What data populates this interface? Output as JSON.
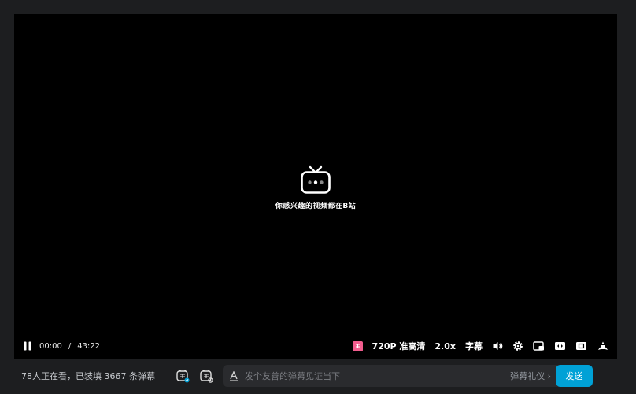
{
  "player": {
    "slogan": "你感兴趣的视频都在B站",
    "controls": {
      "current_time": "00:00",
      "separator": "/",
      "duration": "43:22",
      "quality": "720P 准高清",
      "speed": "2.0x",
      "subtitle": "字幕"
    }
  },
  "bottom_bar": {
    "viewer_info": "78人正在看，已装填 3667 条弹幕",
    "danmaku_placeholder": "发个友善的弹幕见证当下",
    "etiquette_label": "弹幕礼仪",
    "etiquette_arrow": "›",
    "send_label": "发送"
  },
  "colors": {
    "background": "#1d1e20",
    "player_bg": "#000000",
    "accent_blue": "#00a1d6",
    "pink_badge": "#f25d8e"
  },
  "icons": {
    "center": "bilibili-tv-icon",
    "pause": "pause-icon",
    "subtitle_badge": "subtitle-badge-icon",
    "volume": "volume-icon",
    "settings": "gear-icon",
    "pip": "picture-in-picture-icon",
    "wide": "widescreen-icon",
    "web_fullscreen": "web-fullscreen-icon",
    "fullscreen": "fullscreen-icon",
    "danmaku_toggle": "danmaku-toggle-icon",
    "danmaku_settings": "danmaku-settings-icon",
    "font_style": "font-style-icon"
  }
}
